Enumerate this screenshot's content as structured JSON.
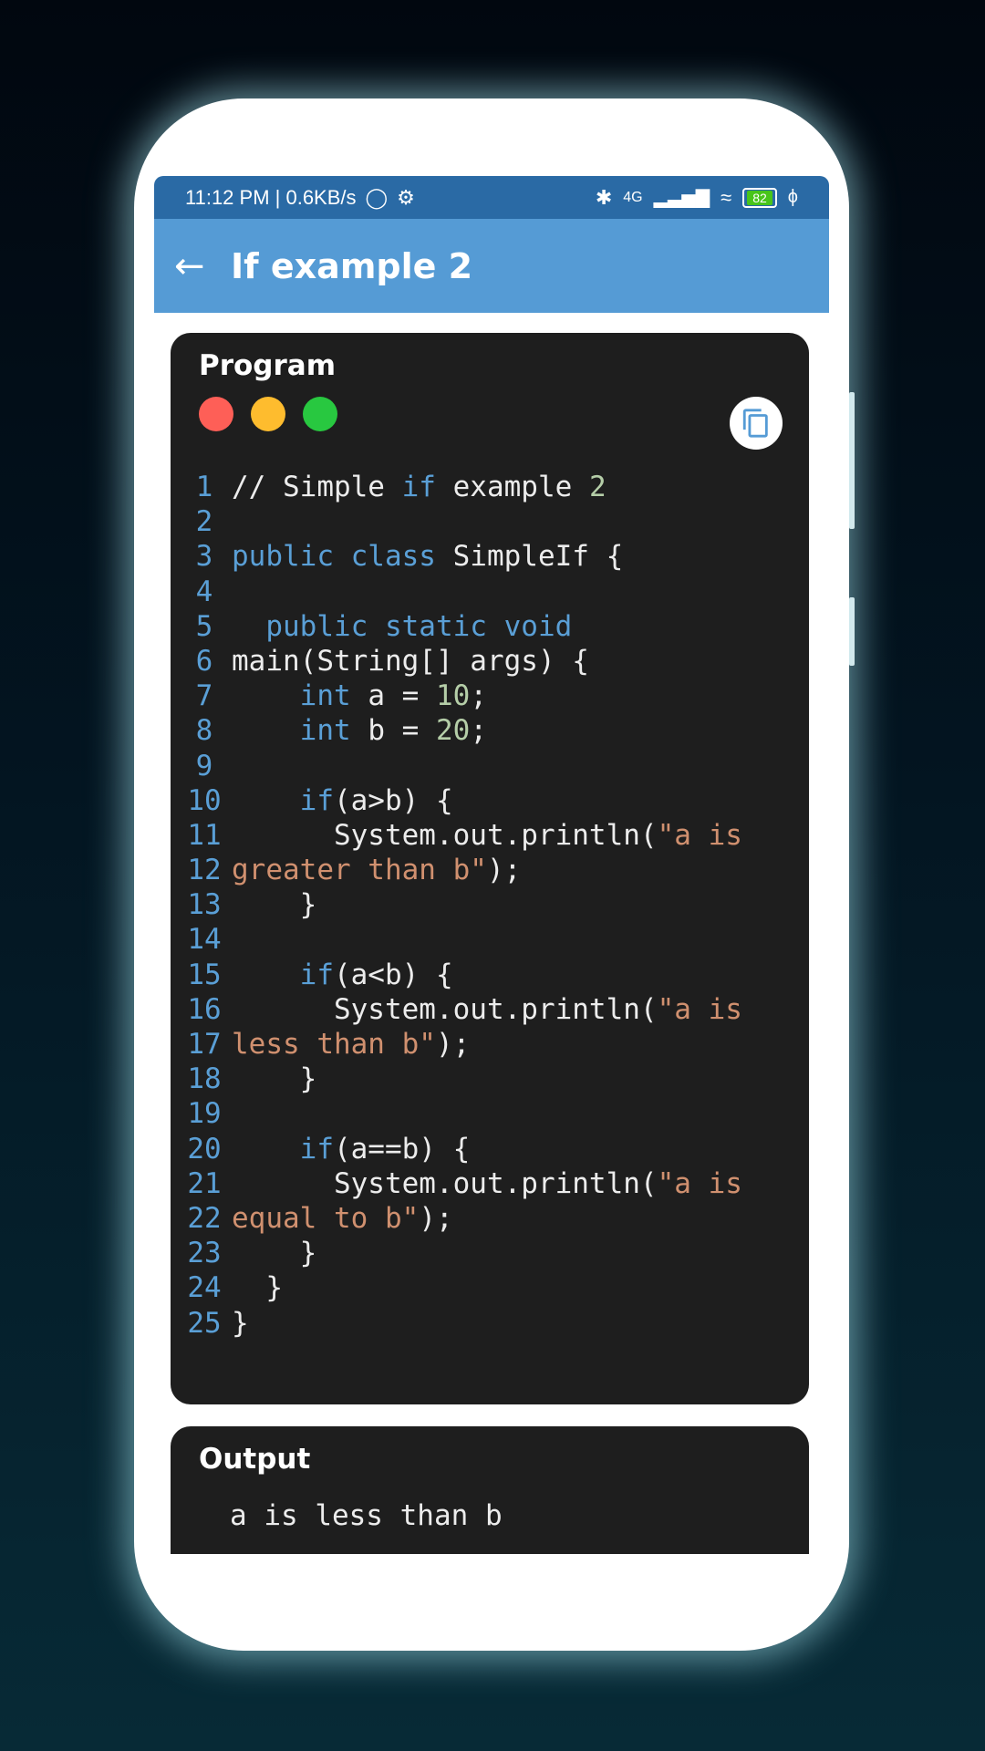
{
  "status_bar": {
    "time": "11:12 PM | 0.6KB/s",
    "network": "4G",
    "battery": "82",
    "icons": [
      "notification-icon",
      "settings-icon",
      "bluetooth-icon",
      "signal-icon",
      "wifi-icon",
      "battery-icon",
      "charging-icon"
    ]
  },
  "app_bar": {
    "back_icon": "←",
    "title": "If example 2"
  },
  "program": {
    "title": "Program",
    "window_dots": [
      "#fe5f57",
      "#febc2e",
      "#28c840"
    ],
    "copy_icon": "copy-icon",
    "lines": [
      [
        [
          "t",
          "// Simple "
        ],
        [
          "k",
          "if"
        ],
        [
          "t",
          " example "
        ],
        [
          "n",
          "2"
        ]
      ],
      [],
      [
        [
          "k",
          "public class"
        ],
        [
          "t",
          " SimpleIf {"
        ]
      ],
      [],
      [
        [
          "t",
          "  "
        ],
        [
          "k",
          "public static void"
        ]
      ],
      [
        [
          "t",
          "main(String[] args) {"
        ]
      ],
      [
        [
          "t",
          "    "
        ],
        [
          "k",
          "int"
        ],
        [
          "t",
          " a = "
        ],
        [
          "n",
          "10"
        ],
        [
          "t",
          ";"
        ]
      ],
      [
        [
          "t",
          "    "
        ],
        [
          "k",
          "int"
        ],
        [
          "t",
          " b = "
        ],
        [
          "n",
          "20"
        ],
        [
          "t",
          ";"
        ]
      ],
      [],
      [
        [
          "t",
          "    "
        ],
        [
          "k",
          "if"
        ],
        [
          "t",
          "(a>b) {"
        ]
      ],
      [
        [
          "t",
          "      System.out.println("
        ],
        [
          "s",
          "\"a is"
        ]
      ],
      [
        [
          "s",
          "greater than b\""
        ],
        [
          "t",
          ");"
        ]
      ],
      [
        [
          "t",
          "    }"
        ]
      ],
      [],
      [
        [
          "t",
          "    "
        ],
        [
          "k",
          "if"
        ],
        [
          "t",
          "(a<b) {"
        ]
      ],
      [
        [
          "t",
          "      System.out.println("
        ],
        [
          "s",
          "\"a is"
        ]
      ],
      [
        [
          "s",
          "less than b\""
        ],
        [
          "t",
          ");"
        ]
      ],
      [
        [
          "t",
          "    }"
        ]
      ],
      [],
      [
        [
          "t",
          "    "
        ],
        [
          "k",
          "if"
        ],
        [
          "t",
          "(a==b) {"
        ]
      ],
      [
        [
          "t",
          "      System.out.println("
        ],
        [
          "s",
          "\"a is"
        ]
      ],
      [
        [
          "s",
          "equal to b\""
        ],
        [
          "t",
          ");"
        ]
      ],
      [
        [
          "t",
          "    }"
        ]
      ],
      [
        [
          "t",
          "  }"
        ]
      ],
      [
        [
          "t",
          "}"
        ]
      ]
    ]
  },
  "output": {
    "title": "Output",
    "text": "a is less than b"
  },
  "colors": {
    "status_bar": "#2a6aa5",
    "app_bar": "#559bd5",
    "card": "#1e1e1e",
    "keyword": "#5a9fd6",
    "string": "#d0906f",
    "number": "#b5cea8"
  }
}
